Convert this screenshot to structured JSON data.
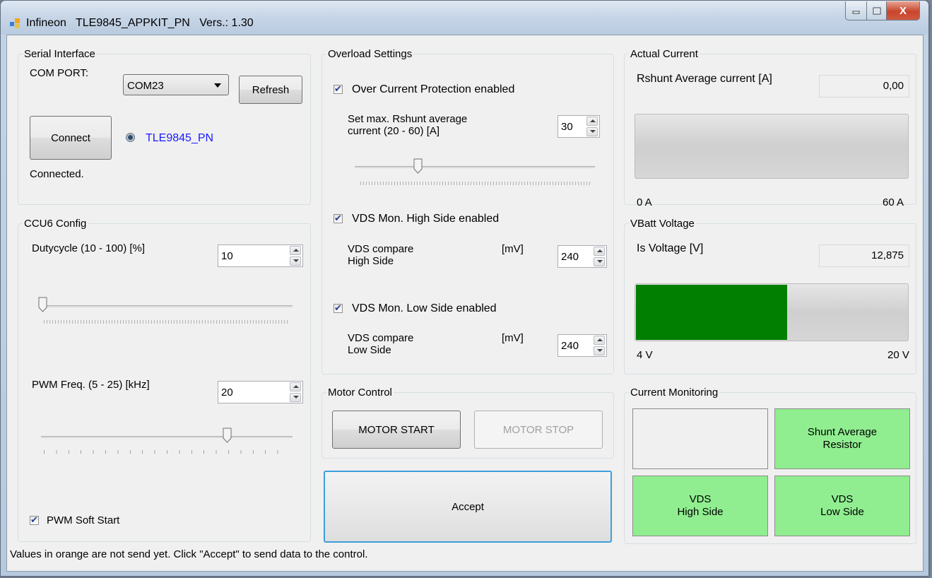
{
  "window": {
    "title": "Infineon   TLE9845_APPKIT_PN   Vers.: 1.30",
    "minimize_label": "minimize",
    "maximize_label": "maximize",
    "close_label": "X"
  },
  "serial": {
    "title": "Serial Interface",
    "com_port_label": "COM PORT:",
    "com_port_value": "COM23",
    "refresh_label": "Refresh",
    "connect_label": "Connect",
    "device_name": "TLE9845_PN",
    "status": "Connected."
  },
  "ccu6": {
    "title": "CCU6 Config",
    "dutycycle_label": "Dutycycle (10 - 100) [%]",
    "dutycycle_value": "10",
    "pwm_freq_label": "PWM Freq. (5 - 25) [kHz]",
    "pwm_freq_value": "20",
    "pwm_soft_start_label": "PWM Soft Start",
    "pwm_soft_start_checked": true
  },
  "overload": {
    "title": "Overload Settings",
    "ocp_label": "Over Current Protection enabled",
    "ocp_checked": true,
    "max_current_label": "Set max. Rshunt average\ncurrent (20 - 60) [A]",
    "max_current_value": "30",
    "vds_high_enabled_label": "VDS Mon. High Side enabled",
    "vds_high_checked": true,
    "vds_high_compare_label": "VDS compare\nHigh Side",
    "vds_high_unit": "[mV]",
    "vds_high_value": "240",
    "vds_low_enabled_label": "VDS Mon. Low Side enabled",
    "vds_low_checked": true,
    "vds_low_compare_label": "VDS compare\nLow Side",
    "vds_low_unit": "[mV]",
    "vds_low_value": "240"
  },
  "motor": {
    "title": "Motor Control",
    "start_label": "MOTOR START",
    "stop_label": "MOTOR STOP"
  },
  "accept_label": "Accept",
  "actual_current": {
    "title": "Actual Current",
    "label": "Rshunt Average current [A]",
    "value": "0,00",
    "min_label": "0 A",
    "max_label": "60 A",
    "level_fraction": 0
  },
  "vbatt": {
    "title": "VBatt Voltage",
    "label": "Is Voltage [V]",
    "value": "12,875",
    "min_label": "4 V",
    "max_label": "20 V",
    "level_fraction": 0.555,
    "fill_color": "#017f01"
  },
  "monitoring": {
    "title": "Current Monitoring",
    "shunt_label": "Shunt Average\nResistor",
    "vds_high_label": "VDS\nHigh Side",
    "vds_low_label": "VDS\nLow Side",
    "active_color": "#90ee90"
  },
  "status_bar": "Values in orange are not send yet. Click \"Accept\" to send data to the control."
}
